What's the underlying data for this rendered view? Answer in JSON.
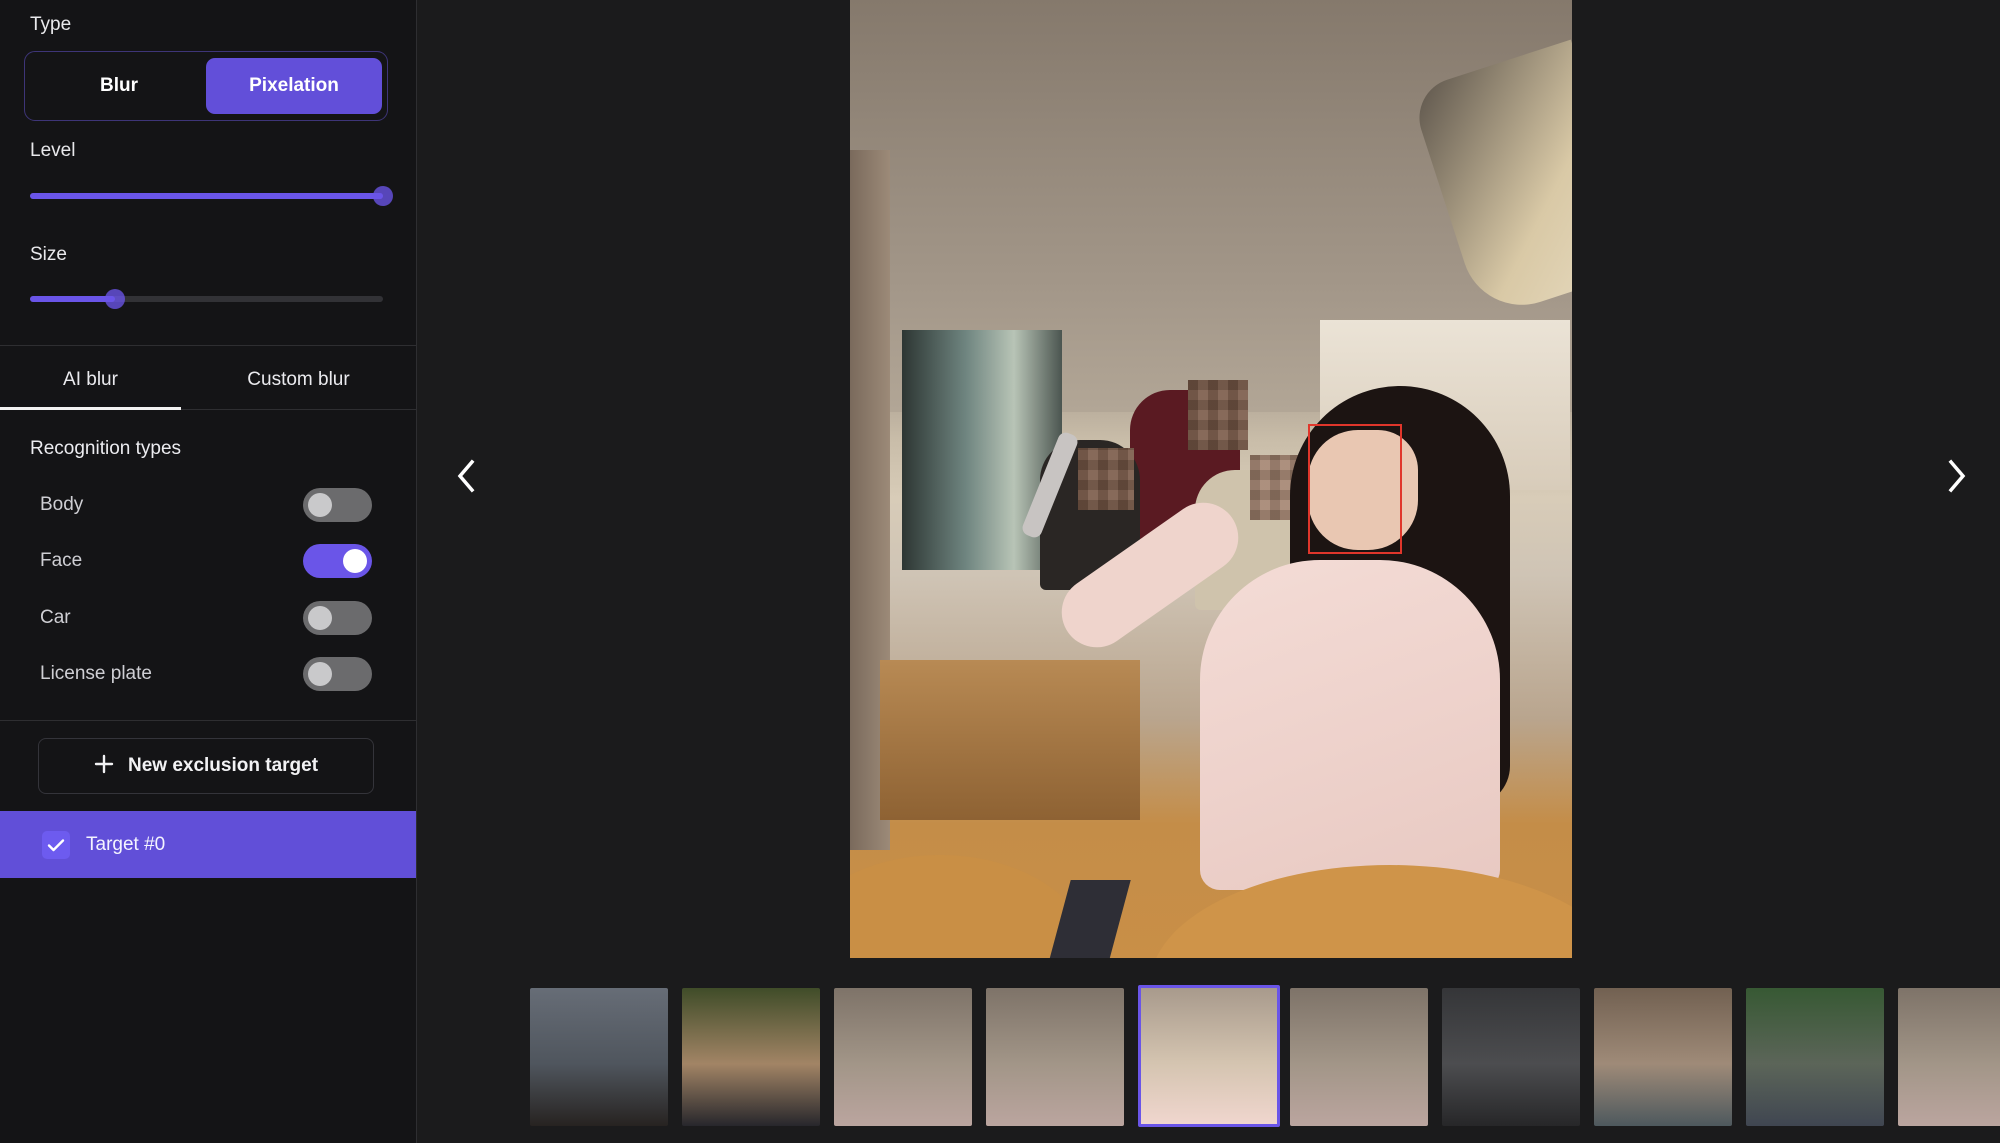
{
  "colors": {
    "accent": "#624fd9",
    "toggle_on": "#6a55e8",
    "toggle_off": "#6b6b6d",
    "face_box": "#e0362b",
    "panel_bg": "#141416",
    "viewer_bg": "#1b1b1c"
  },
  "settings": {
    "type_label": "Type",
    "type_options": [
      {
        "label": "Blur",
        "selected": false
      },
      {
        "label": "Pixelation",
        "selected": true
      }
    ],
    "level_label": "Level",
    "level_value_percent": 100,
    "size_label": "Size",
    "size_value_percent": 24
  },
  "tabs": [
    {
      "label": "AI blur",
      "active": true
    },
    {
      "label": "Custom blur",
      "active": false
    }
  ],
  "recognition": {
    "title": "Recognition types",
    "items": [
      {
        "label": "Body",
        "enabled": false
      },
      {
        "label": "Face",
        "enabled": true
      },
      {
        "label": "Car",
        "enabled": false
      },
      {
        "label": "License plate",
        "enabled": false
      }
    ]
  },
  "exclusion": {
    "new_button_label": "New exclusion target",
    "new_button_icon": "plus-icon",
    "targets": [
      {
        "label": "Target #0",
        "checked": true
      }
    ]
  },
  "viewer": {
    "prev_icon": "chevron-left-icon",
    "next_icon": "chevron-right-icon",
    "image_description": "Cafe interior; woman taking selfie with face outlined; background faces pixelated"
  },
  "filmstrip": {
    "selected_index": 4,
    "thumbnails": [
      {
        "description": "Group jumping on rocky beach at dusk",
        "colors": [
          "#7c8490",
          "#5e6670",
          "#2a2522"
        ]
      },
      {
        "description": "People sitting on grass with box",
        "colors": [
          "#4a5a2c",
          "#c8a27a",
          "#2a2a30"
        ]
      },
      {
        "description": "Cafe selfie scene",
        "colors": [
          "#9a8c7e",
          "#c8b8a6",
          "#e8ccc4"
        ]
      },
      {
        "description": "Cafe selfie scene",
        "colors": [
          "#9a8c7e",
          "#c8b8a6",
          "#e8ccc4"
        ]
      },
      {
        "description": "Cafe selfie scene (current)",
        "colors": [
          "#a89a8c",
          "#d4c4b0",
          "#f0d6ce"
        ]
      },
      {
        "description": "Cafe selfie scene",
        "colors": [
          "#9a8c7e",
          "#c8b8a6",
          "#e8ccc4"
        ]
      },
      {
        "description": "Parking garage with car",
        "colors": [
          "#3c3d40",
          "#5a5b5e",
          "#2a2a2c"
        ]
      },
      {
        "description": "Crowd celebrating outdoors",
        "colors": [
          "#8a7460",
          "#c4aa92",
          "#5c6a70"
        ]
      },
      {
        "description": "Street market with trees",
        "colors": [
          "#3f6a3a",
          "#6e7a6a",
          "#4a5260"
        ]
      },
      {
        "description": "Cafe selfie scene",
        "colors": [
          "#9a8c7e",
          "#c8b8a6",
          "#e8ccc4"
        ]
      }
    ]
  }
}
